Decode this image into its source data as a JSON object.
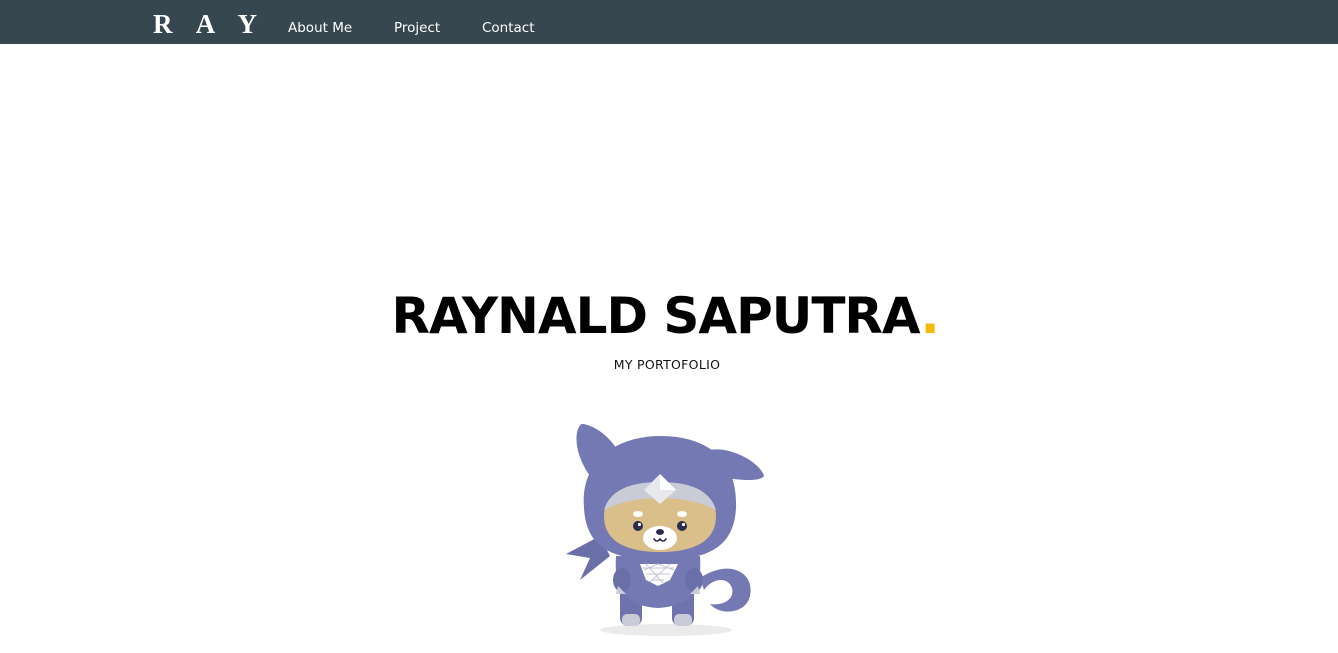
{
  "navbar": {
    "brand": "R A Y",
    "links": [
      {
        "label": "About Me"
      },
      {
        "label": "Project"
      },
      {
        "label": "Contact"
      }
    ]
  },
  "hero": {
    "name": "RAYNALD SAPUTRA",
    "accent_dot": ".",
    "subtitle": "MY PORTOFOLIO"
  },
  "colors": {
    "navbar_bg": "#37474f",
    "accent": "#f5b800",
    "mascot_body": "#7479b3"
  },
  "mascot": {
    "icon": "ninja-dog-mascot"
  }
}
